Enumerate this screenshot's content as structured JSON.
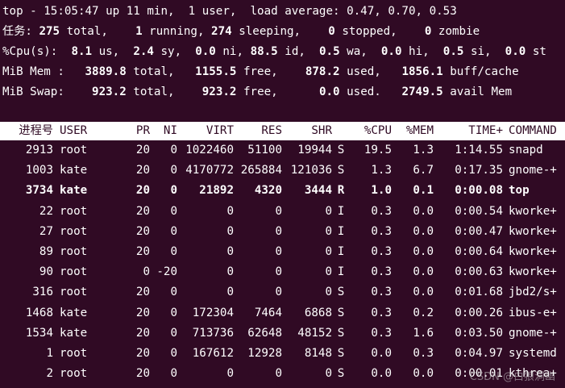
{
  "summary": {
    "line1": "top - 15:05:47 up 11 min,  1 user,  load average: 0.47, 0.70, 0.53",
    "tasks": {
      "label": "任务:",
      "total": "275",
      "total_label": " total,",
      "running": "1",
      "running_label": " running,",
      "sleeping": "274",
      "sleeping_label": " sleeping,",
      "stopped": "0",
      "stopped_label": " stopped,",
      "zombie": "0",
      "zombie_label": " zombie"
    },
    "cpu": {
      "label": "%Cpu(s):",
      "us": "8.1",
      "us_label": " us,",
      "sy": "2.4",
      "sy_label": " sy,",
      "ni": "0.0",
      "ni_label": " ni,",
      "id": "88.5",
      "id_label": " id,",
      "wa": "0.5",
      "wa_label": " wa,",
      "hi": "0.0",
      "hi_label": " hi,",
      "si": "0.5",
      "si_label": " si,",
      "st": "0.0",
      "st_label": " st"
    },
    "mem": {
      "label": "MiB Mem :",
      "total": "3889.8",
      "total_label": " total,",
      "free": "1155.5",
      "free_label": " free,",
      "used": "878.2",
      "used_label": " used,",
      "buff": "1856.1",
      "buff_label": " buff/cache"
    },
    "swap": {
      "label": "MiB Swap:",
      "total": "923.2",
      "total_label": " total,",
      "free": "923.2",
      "free_label": " free,",
      "used": "0.0",
      "used_label": " used.",
      "avail": "2749.5",
      "avail_label": " avail Mem"
    }
  },
  "table": {
    "headers": [
      "进程号",
      "USER",
      "PR",
      "NI",
      "VIRT",
      "RES",
      "SHR",
      "",
      "%CPU",
      "%MEM",
      "TIME+",
      "COMMAND"
    ],
    "rows": [
      {
        "pid": "2913",
        "user": "root",
        "pr": "20",
        "ni": "0",
        "virt": "1022460",
        "res": "51100",
        "shr": "19944",
        "s": "S",
        "cpu": "19.5",
        "mem": "1.3",
        "time": "1:14.55",
        "cmd": "snapd",
        "bold": false
      },
      {
        "pid": "1003",
        "user": "kate",
        "pr": "20",
        "ni": "0",
        "virt": "4170772",
        "res": "265884",
        "shr": "121036",
        "s": "S",
        "cpu": "1.3",
        "mem": "6.7",
        "time": "0:17.35",
        "cmd": "gnome-+",
        "bold": false
      },
      {
        "pid": "3734",
        "user": "kate",
        "pr": "20",
        "ni": "0",
        "virt": "21892",
        "res": "4320",
        "shr": "3444",
        "s": "R",
        "cpu": "1.0",
        "mem": "0.1",
        "time": "0:00.08",
        "cmd": "top",
        "bold": true
      },
      {
        "pid": "22",
        "user": "root",
        "pr": "20",
        "ni": "0",
        "virt": "0",
        "res": "0",
        "shr": "0",
        "s": "I",
        "cpu": "0.3",
        "mem": "0.0",
        "time": "0:00.54",
        "cmd": "kworke+",
        "bold": false
      },
      {
        "pid": "27",
        "user": "root",
        "pr": "20",
        "ni": "0",
        "virt": "0",
        "res": "0",
        "shr": "0",
        "s": "I",
        "cpu": "0.3",
        "mem": "0.0",
        "time": "0:00.47",
        "cmd": "kworke+",
        "bold": false
      },
      {
        "pid": "89",
        "user": "root",
        "pr": "20",
        "ni": "0",
        "virt": "0",
        "res": "0",
        "shr": "0",
        "s": "I",
        "cpu": "0.3",
        "mem": "0.0",
        "time": "0:00.64",
        "cmd": "kworke+",
        "bold": false
      },
      {
        "pid": "90",
        "user": "root",
        "pr": "0",
        "ni": "-20",
        "virt": "0",
        "res": "0",
        "shr": "0",
        "s": "I",
        "cpu": "0.3",
        "mem": "0.0",
        "time": "0:00.63",
        "cmd": "kworke+",
        "bold": false
      },
      {
        "pid": "316",
        "user": "root",
        "pr": "20",
        "ni": "0",
        "virt": "0",
        "res": "0",
        "shr": "0",
        "s": "S",
        "cpu": "0.3",
        "mem": "0.0",
        "time": "0:01.68",
        "cmd": "jbd2/s+",
        "bold": false
      },
      {
        "pid": "1468",
        "user": "kate",
        "pr": "20",
        "ni": "0",
        "virt": "172304",
        "res": "7464",
        "shr": "6868",
        "s": "S",
        "cpu": "0.3",
        "mem": "0.2",
        "time": "0:00.26",
        "cmd": "ibus-e+",
        "bold": false
      },
      {
        "pid": "1534",
        "user": "kate",
        "pr": "20",
        "ni": "0",
        "virt": "713736",
        "res": "62648",
        "shr": "48152",
        "s": "S",
        "cpu": "0.3",
        "mem": "1.6",
        "time": "0:03.50",
        "cmd": "gnome-+",
        "bold": false
      },
      {
        "pid": "1",
        "user": "root",
        "pr": "20",
        "ni": "0",
        "virt": "167612",
        "res": "12928",
        "shr": "8148",
        "s": "S",
        "cpu": "0.0",
        "mem": "0.3",
        "time": "0:04.97",
        "cmd": "systemd",
        "bold": false
      },
      {
        "pid": "2",
        "user": "root",
        "pr": "20",
        "ni": "0",
        "virt": "0",
        "res": "0",
        "shr": "0",
        "s": "S",
        "cpu": "0.0",
        "mem": "0.0",
        "time": "0:00.01",
        "cmd": "kthrea+",
        "bold": false
      }
    ]
  },
  "watermark": "CSDN @白狼洞幽"
}
